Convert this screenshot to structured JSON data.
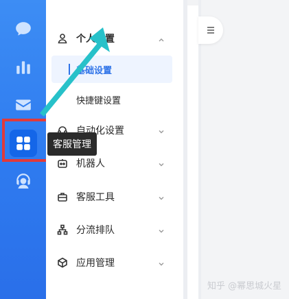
{
  "tooltip": "客服管理",
  "menu": {
    "personal_settings": "个人设置",
    "basic_settings": "基础设置",
    "shortcut_settings": "快捷键设置",
    "automation_settings": "自动化设置",
    "robot": "机器人",
    "service_tools": "客服工具",
    "routing_queue": "分流排队",
    "app_management": "应用管理"
  },
  "watermark": "知乎 @幂思城火星",
  "colors": {
    "rail": "#2f7cf0",
    "active": "#1466e8",
    "highlight_box": "#e13a3a",
    "arrow": "#27c1c9"
  }
}
